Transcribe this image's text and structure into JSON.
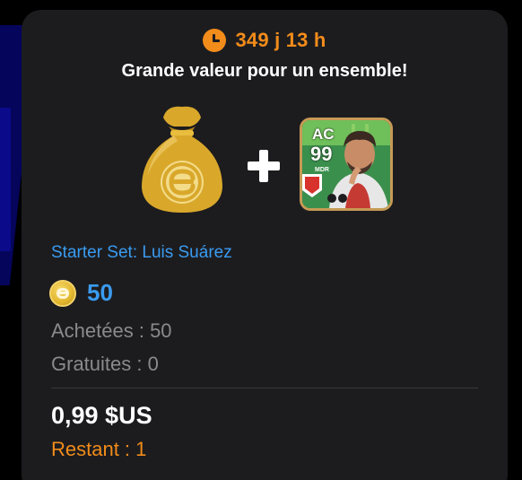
{
  "offer": {
    "timer_text": "349 j 13 h",
    "headline": "Grande valeur pour un ensemble!",
    "name": "Starter Set: Luis Suárez",
    "coin_amount": "50",
    "purchased_text": "Achetées : 50",
    "free_text": "Gratuites : 0",
    "price": "0,99 $US",
    "remaining_text": "Restant : 1"
  },
  "player_card": {
    "position": "AC",
    "rating": "99",
    "team": "MDR"
  },
  "icons": {
    "timer": "clock-icon",
    "bag": "coin-bag-icon",
    "plus": "plus-icon",
    "coin": "coin-icon"
  },
  "colors": {
    "accent_orange": "#f28c1a",
    "accent_blue": "#3a9bf0",
    "card_bg": "#1c1c1f",
    "muted_text": "#8a8a8d",
    "gold": "#d9a82b"
  }
}
